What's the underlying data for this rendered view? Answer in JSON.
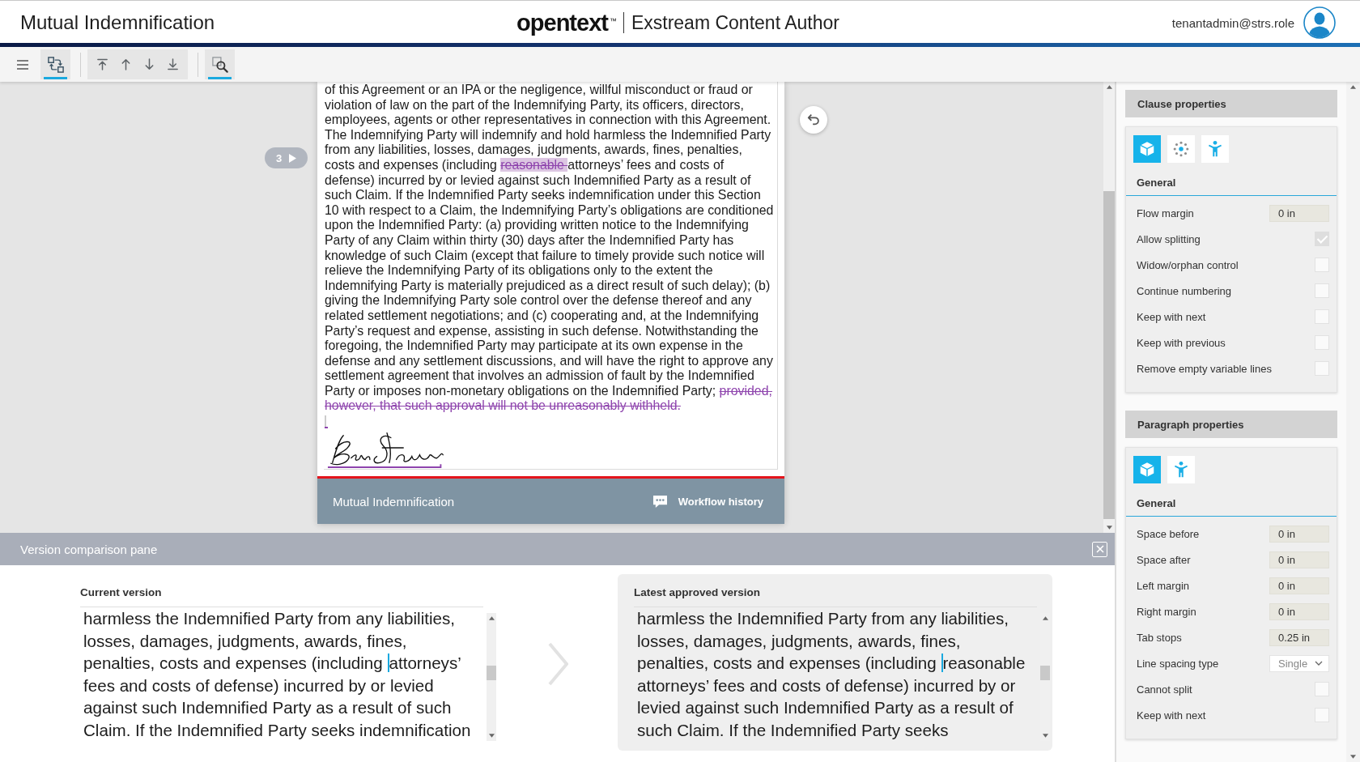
{
  "header": {
    "title": "Mutual Indemnification",
    "logo": "opentext",
    "trademark": "™",
    "product": "Exstream Content Author",
    "user": "tenantadmin@strs.role"
  },
  "toolbar": {
    "groups": [
      {
        "items": [
          {
            "kind": "menu",
            "selected": false
          }
        ]
      },
      {
        "items": [
          {
            "kind": "structure",
            "selected": true
          }
        ]
      },
      {
        "items": [
          {
            "kind": "first",
            "selected": false
          },
          {
            "kind": "previous",
            "selected": false
          },
          {
            "kind": "next",
            "selected": false
          },
          {
            "kind": "last",
            "selected": false
          }
        ]
      },
      {
        "items": [
          {
            "kind": "find",
            "selected": true
          }
        ]
      }
    ]
  },
  "editor": {
    "change_count": "3",
    "paragraph": [
      {
        "kind": "text",
        "highlighted": false,
        "text": "of this Agreement or an IPA or the negligence, willful misconduct or fraud or violation of law on the part of the Indemnifying Party, its officers, directors, employees, agents or other representatives in connection with this Agreement. The Indemnifying Party will indemnify and hold harmless the Indemnified Party from any liabilities, losses, damages, judgments, awards, fines, penalties, costs and expenses (including "
      },
      {
        "kind": "deleted",
        "highlighted": true,
        "text": "reasonable "
      },
      {
        "kind": "text",
        "highlighted": false,
        "text": "attorneys’ fees and costs of defense) incurred by or levied against such Indemnified Party as a result of such Claim. If the Indemnified Party seeks indemnification under this Section 10 with respect to a Claim, the Indemnifying Party’s obligations are conditioned upon the Indemnified Party: (a) providing written notice to the Indemnifying Party of any Claim within thirty (30) days after the Indemnified Party has knowledge of such Claim (except that failure to timely provide such notice will relieve the Indemnifying Party of its obligations only to the extent the Indemnifying Party is materially prejudiced as a direct result of such delay); (b) giving the Indemnifying Party sole control over the defense thereof and any related settlement negotiations; and (c) cooperating and, at the Indemnifying Party’s request and expense, assisting in such defense. Notwithstanding the foregoing, the Indemnified Party may participate at its own expense in the defense and any settlement discussions, and will have the right to approve any settlement agreement that involves an admission of fault by the Indemnified Party or imposes non-monetary obligations on the Indemnified Party; "
      },
      {
        "kind": "deleted",
        "highlighted": false,
        "text": "provided, however, that such approval will not be unreasonably withheld."
      }
    ],
    "footer": {
      "title": "Mutual Indemnification",
      "action": "Workflow history"
    }
  },
  "comparison": {
    "title": "Version comparison pane",
    "panes": [
      {
        "heading": "Current version",
        "selected": false,
        "text_before_caret": "harmless the Indemnified Party from any liabilities, losses, damages, judgments, awards, fines, penalties, costs and expenses (including ",
        "text_after_caret": "attorneys’ fees and costs of defense) incurred by or levied against such Indemnified Party as a result of such Claim. If the Indemnified Party seeks indemnification"
      },
      {
        "heading": "Latest approved version",
        "selected": true,
        "text_before_caret": "harmless the Indemnified Party from any liabilities, losses, damages, judgments, awards, fines, penalties, costs and expenses (including ",
        "text_after_caret": "reasonable attorneys’ fees and costs of defense) incurred by or levied against such Indemnified Party as a result of such Claim. If the Indemnified Party seeks"
      }
    ]
  },
  "properties": [
    {
      "title": "Clause properties",
      "tabs": [
        {
          "kind": "layout",
          "selected": true
        },
        {
          "kind": "variables",
          "selected": false
        },
        {
          "kind": "accessibility",
          "selected": false
        }
      ],
      "group": "General",
      "rows": [
        {
          "kind": "input",
          "label": "Flow margin",
          "value": "0 in"
        },
        {
          "kind": "checkbox",
          "label": "Allow splitting",
          "checked": true
        },
        {
          "kind": "checkbox",
          "label": "Widow/orphan control",
          "checked": false
        },
        {
          "kind": "checkbox",
          "label": "Continue numbering",
          "checked": false
        },
        {
          "kind": "checkbox",
          "label": "Keep with next",
          "checked": false
        },
        {
          "kind": "checkbox",
          "label": "Keep with previous",
          "checked": false
        },
        {
          "kind": "checkbox",
          "label": "Remove empty variable lines",
          "checked": false
        }
      ]
    },
    {
      "title": "Paragraph properties",
      "tabs": [
        {
          "kind": "layout",
          "selected": true
        },
        {
          "kind": "accessibility",
          "selected": false
        }
      ],
      "group": "General",
      "rows": [
        {
          "kind": "input",
          "label": "Space before",
          "value": "0 in"
        },
        {
          "kind": "input",
          "label": "Space after",
          "value": "0 in"
        },
        {
          "kind": "input",
          "label": "Left margin",
          "value": "0 in"
        },
        {
          "kind": "input",
          "label": "Right margin",
          "value": "0 in"
        },
        {
          "kind": "input",
          "label": "Tab stops",
          "value": "0.25 in"
        },
        {
          "kind": "dropdown",
          "label": "Line spacing type",
          "value": "Single"
        },
        {
          "kind": "checkbox",
          "label": "Cannot split",
          "checked": false
        },
        {
          "kind": "checkbox",
          "label": "Keep with next",
          "checked": false
        }
      ]
    }
  ]
}
